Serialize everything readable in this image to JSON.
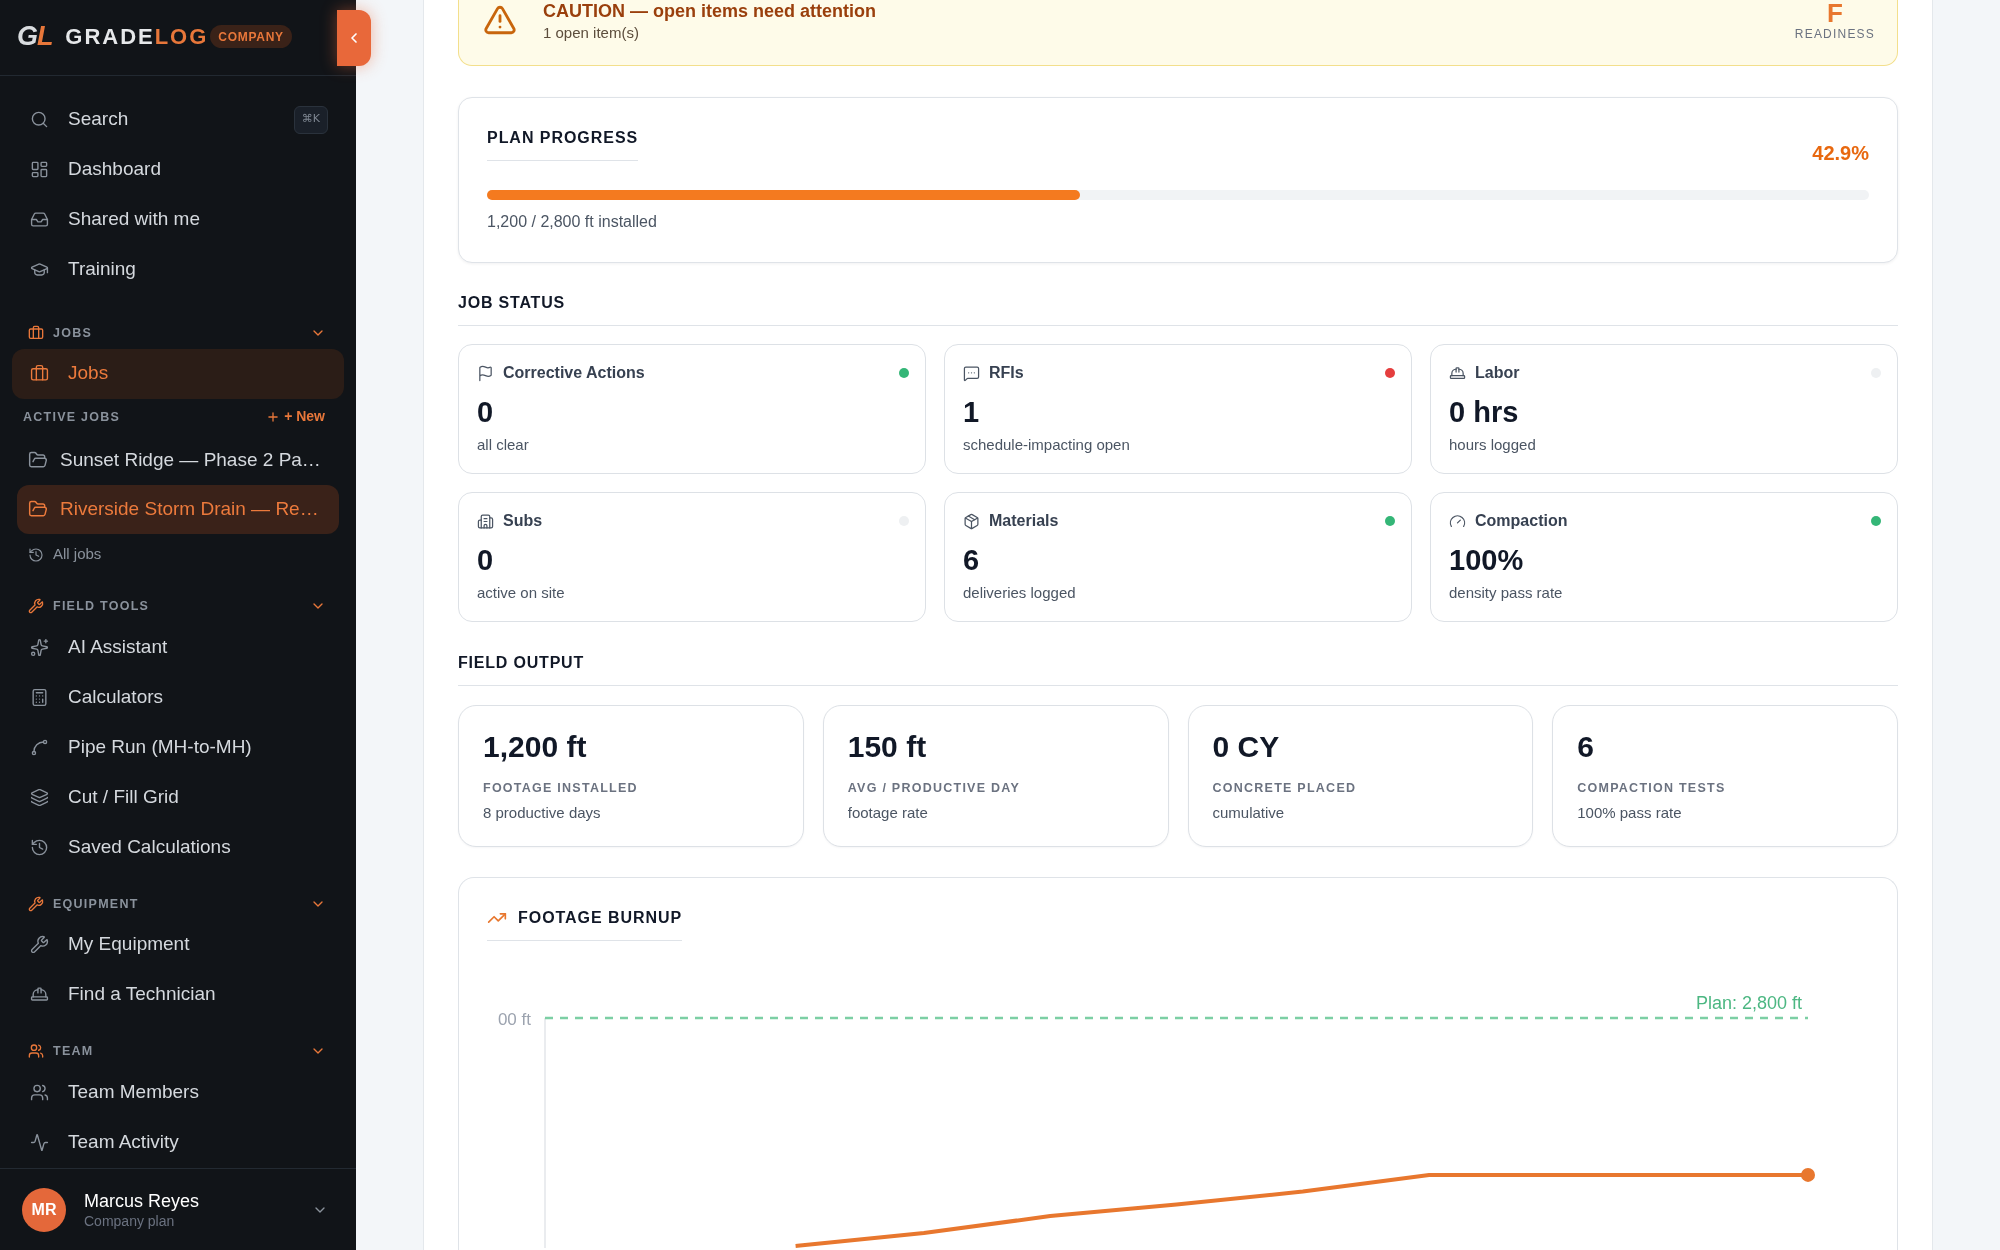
{
  "sidebar": {
    "brand": {
      "mark": [
        "G",
        "L"
      ],
      "wordmark": [
        "GRADE",
        "LOG"
      ],
      "badge": "COMPANY"
    },
    "search": {
      "label": "Search",
      "shortcut": "⌘K"
    },
    "top_items": [
      {
        "label": "Dashboard",
        "selected": false
      },
      {
        "label": "Shared with me",
        "selected": false
      },
      {
        "label": "Training",
        "selected": false
      }
    ],
    "jobs_section": {
      "title": "JOBS",
      "expanded": true,
      "items": [
        {
          "label": "Jobs",
          "selected": true
        }
      ],
      "active_jobs": {
        "title": "ACTIVE JOBS",
        "new_label": "+ New",
        "jobs": [
          {
            "label": "Sunset Ridge — Phase 2 Pa…",
            "selected": false
          },
          {
            "label": "Riverside Storm Drain — Re…",
            "selected": true
          }
        ],
        "all_jobs_label": "All jobs"
      }
    },
    "sections": [
      {
        "title": "FIELD TOOLS",
        "expanded": true,
        "items": [
          {
            "label": "AI Assistant",
            "selected": false
          },
          {
            "label": "Calculators",
            "selected": false
          },
          {
            "label": "Pipe Run (MH-to-MH)",
            "selected": false
          },
          {
            "label": "Cut / Fill Grid",
            "selected": false
          },
          {
            "label": "Saved Calculations",
            "selected": false
          }
        ]
      },
      {
        "title": "EQUIPMENT",
        "expanded": true,
        "items": [
          {
            "label": "My Equipment",
            "selected": false
          },
          {
            "label": "Find a Technician",
            "selected": false
          }
        ]
      },
      {
        "title": "TEAM",
        "expanded": true,
        "items": [
          {
            "label": "Team Members",
            "selected": false
          },
          {
            "label": "Team Activity",
            "selected": false
          }
        ]
      }
    ],
    "user": {
      "initials": "MR",
      "name": "Marcus Reyes",
      "plan": "Company plan"
    }
  },
  "alert": {
    "title": "CAUTION — open items need attention",
    "detail": "1 open item(s)",
    "grade": "F",
    "grade_label": "READINESS"
  },
  "plan_progress": {
    "title": "PLAN PROGRESS",
    "percent": "42.9%",
    "level": 0.429,
    "detail": "1,200 / 2,800 ft installed"
  },
  "job_status": {
    "title": "JOB STATUS",
    "cards": [
      {
        "label": "Corrective Actions",
        "value": "0",
        "detail": "all clear",
        "color": "#34b677"
      },
      {
        "label": "RFIs",
        "value": "1",
        "detail": "schedule-impacting open",
        "color": "#e53e3e"
      },
      {
        "label": "Labor",
        "value": "0 hrs",
        "detail": "hours logged",
        "color": "#eef0f2"
      },
      {
        "label": "Subs",
        "value": "0",
        "detail": "active on site",
        "color": "#eef0f2"
      },
      {
        "label": "Materials",
        "value": "6",
        "detail": "deliveries logged",
        "color": "#34b677"
      },
      {
        "label": "Compaction",
        "value": "100%",
        "detail": "density pass rate",
        "color": "#34b677"
      }
    ]
  },
  "field_output": {
    "title": "FIELD OUTPUT",
    "cards": [
      {
        "value": "1,200 ft",
        "label": "FOOTAGE INSTALLED",
        "detail": "8 productive days"
      },
      {
        "value": "150 ft",
        "label": "AVG / PRODUCTIVE DAY",
        "detail": "footage rate"
      },
      {
        "value": "0 CY",
        "label": "CONCRETE PLACED",
        "detail": "cumulative"
      },
      {
        "value": "6",
        "label": "COMPACTION TESTS",
        "detail": "100% pass rate"
      }
    ]
  },
  "footage_burnup": {
    "title": "FOOTAGE BURNUP",
    "axis_label": "00 ft",
    "plan_label": "Plan: 2,800 ft"
  }
}
